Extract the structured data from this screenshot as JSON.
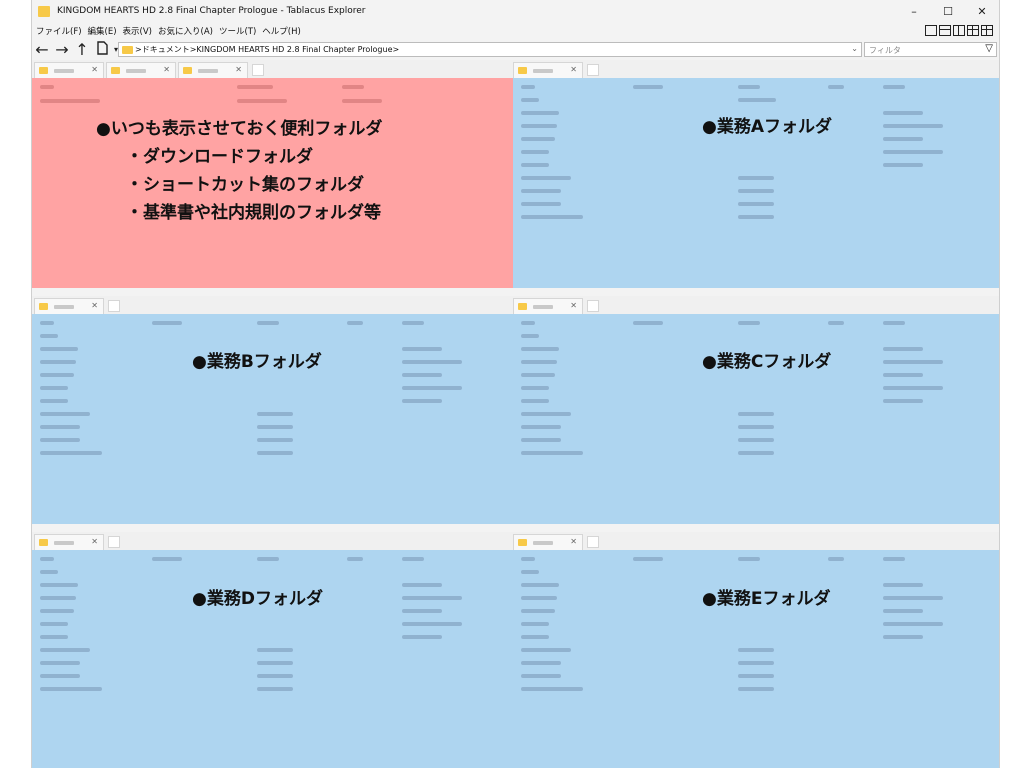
{
  "window": {
    "title": "KINGDOM HEARTS HD 2.8 Final Chapter Prologue - Tablacus Explorer",
    "controls": [
      "–",
      "☐",
      "✕"
    ]
  },
  "menu": [
    "ファイル(F)",
    "編集(E)",
    "表示(V)",
    "お気に入り(A)",
    "ツール(T)",
    "ヘルプ(H)"
  ],
  "toolbar": {
    "back": "←",
    "forward": "→",
    "up": "↑",
    "path_sep": ">",
    "breadcrumb": [
      "ドキュメント",
      "KINGDOM HEARTS HD 2.8 Final Chapter Prologue"
    ],
    "filter_placeholder": "フィルタ"
  },
  "panes": {
    "top_left": {
      "lines": [
        "●いつも表示させておく便利フォルダ",
        "・ダウンロードフォルダ",
        "・ショートカット集のフォルダ",
        "・基準書や社内規則のフォルダ等"
      ]
    },
    "top_right": {
      "label": "●業務Aフォルダ"
    },
    "mid_left": {
      "label": "●業務Bフォルダ"
    },
    "mid_right": {
      "label": "●業務Cフォルダ"
    },
    "bot_left": {
      "label": "●業務Dフォルダ"
    },
    "bot_right": {
      "label": "●業務Eフォルダ"
    }
  },
  "colors": {
    "highlight_red": "#ffa3a3",
    "highlight_blue": "#aed5f0"
  },
  "icons": {
    "folder": "folder-icon",
    "filter": "filter-icon"
  }
}
